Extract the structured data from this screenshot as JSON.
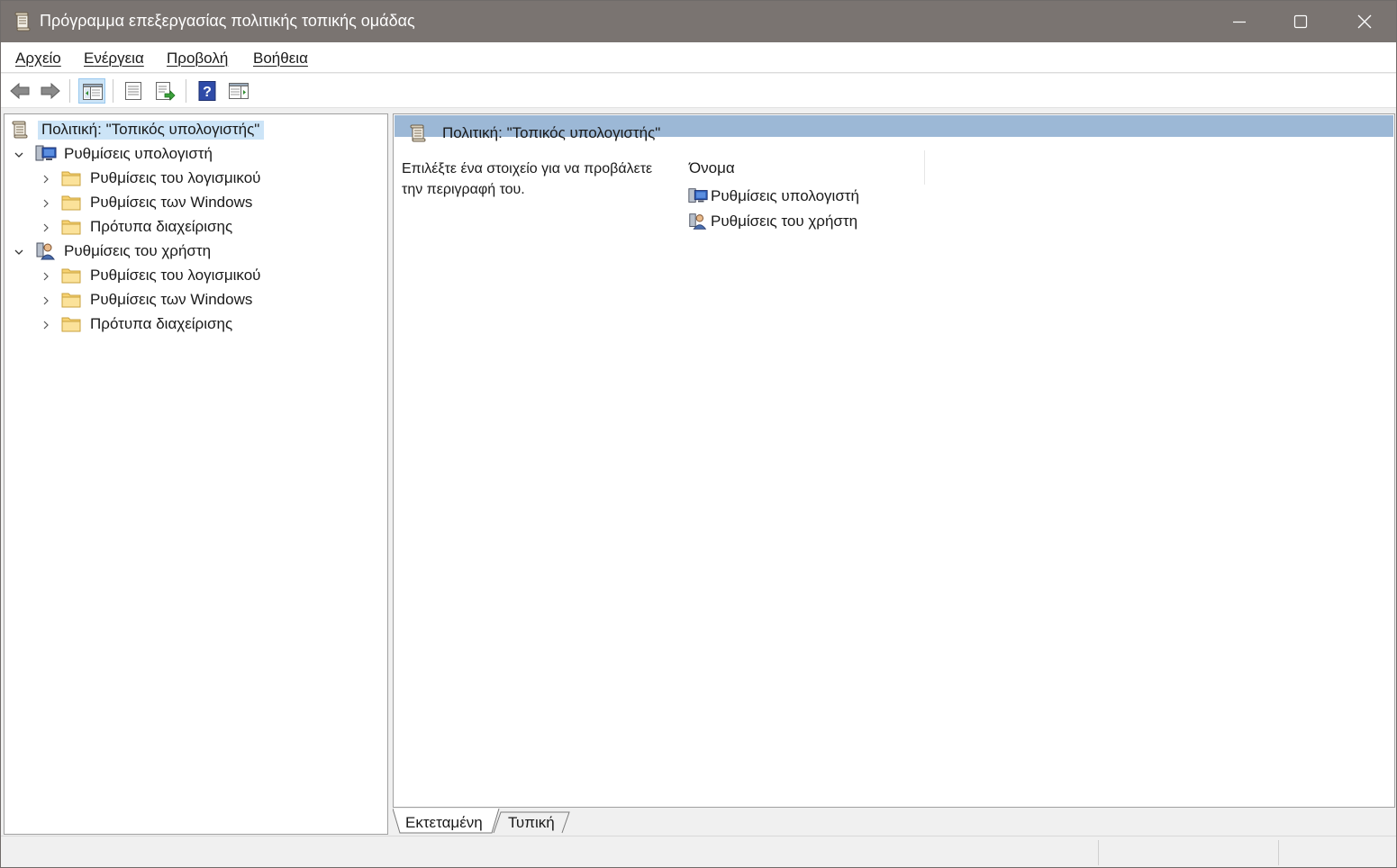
{
  "window": {
    "title": "Πρόγραμμα επεξεργασίας πολιτικής τοπικής ομάδας",
    "app_icon": "policy-scroll-icon",
    "controls": [
      "minimize-icon",
      "maximize-icon",
      "close-icon"
    ]
  },
  "menu": {
    "items": [
      {
        "underline": "Α",
        "rest": "ρχείο"
      },
      {
        "underline": "Ε",
        "rest": "νέργεια"
      },
      {
        "underline": "Π",
        "rest": "ροβολή"
      },
      {
        "underline": "Β",
        "rest": "οήθεια"
      }
    ]
  },
  "toolbar": {
    "buttons": [
      "back-arrow-icon",
      "forward-arrow-icon",
      "show-hide-console-tree-icon",
      "properties-list-icon",
      "export-list-icon",
      "help-icon",
      "show-hide-action-pane-icon"
    ],
    "active": "show-hide-console-tree-icon"
  },
  "tree": {
    "root": "Πολιτική: \"Τοπικός υπολογιστής\"",
    "computer": {
      "label": "Ρυθμίσεις υπολογιστή",
      "children": [
        "Ρυθμίσεις του λογισμικού",
        "Ρυθμίσεις των Windows",
        "Πρότυπα διαχείρισης"
      ]
    },
    "user": {
      "label": "Ρυθμίσεις του χρήστη",
      "children": [
        "Ρυθμίσεις του λογισμικού",
        "Ρυθμίσεις των Windows",
        "Πρότυπα διαχείρισης"
      ]
    }
  },
  "details": {
    "title": "Πολιτική: \"Τοπικός υπολογιστής\"",
    "description": "Επιλέξτε ένα στοιχείο για να προβάλετε την περιγραφή του.",
    "column_name": "Όνομα",
    "items": [
      "Ρυθμίσεις υπολογιστή",
      "Ρυθμίσεις του χρήστη"
    ]
  },
  "tabs": {
    "extended": "Εκτεταμένη",
    "standard": "Τυπική",
    "selected": "Εκτεταμένη"
  },
  "colors": {
    "titlebar": "#7a7471",
    "selection": "#cce4f7",
    "header_band": "#9cb8d6"
  }
}
